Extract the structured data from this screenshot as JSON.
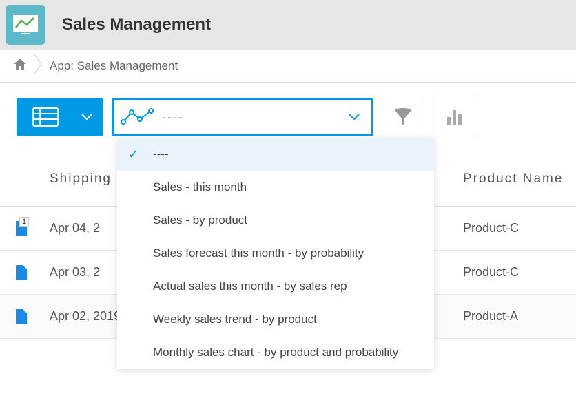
{
  "header": {
    "title": "Sales Management"
  },
  "breadcrumb": {
    "app_label": "App: Sales Management"
  },
  "graph_select": {
    "current": "----"
  },
  "dropdown": {
    "items": [
      {
        "label": "----",
        "selected": true
      },
      {
        "label": "Sales - this month",
        "selected": false
      },
      {
        "label": "Sales - by product",
        "selected": false
      },
      {
        "label": "Sales forecast this month - by probability",
        "selected": false
      },
      {
        "label": "Actual sales this month - by sales rep",
        "selected": false
      },
      {
        "label": "Weekly sales trend - by product",
        "selected": false
      },
      {
        "label": "Monthly sales chart - by product and probability",
        "selected": false
      }
    ]
  },
  "table": {
    "headers": {
      "date": "Shipping",
      "product": "Product Name"
    },
    "rows": [
      {
        "date": "Apr 04, 2",
        "product": "Product-C",
        "badge": "1"
      },
      {
        "date": "Apr 03, 2",
        "product": "Product-C",
        "badge": null
      },
      {
        "date": "Apr 02, 2019",
        "product": "Product-A",
        "badge": null
      }
    ]
  }
}
